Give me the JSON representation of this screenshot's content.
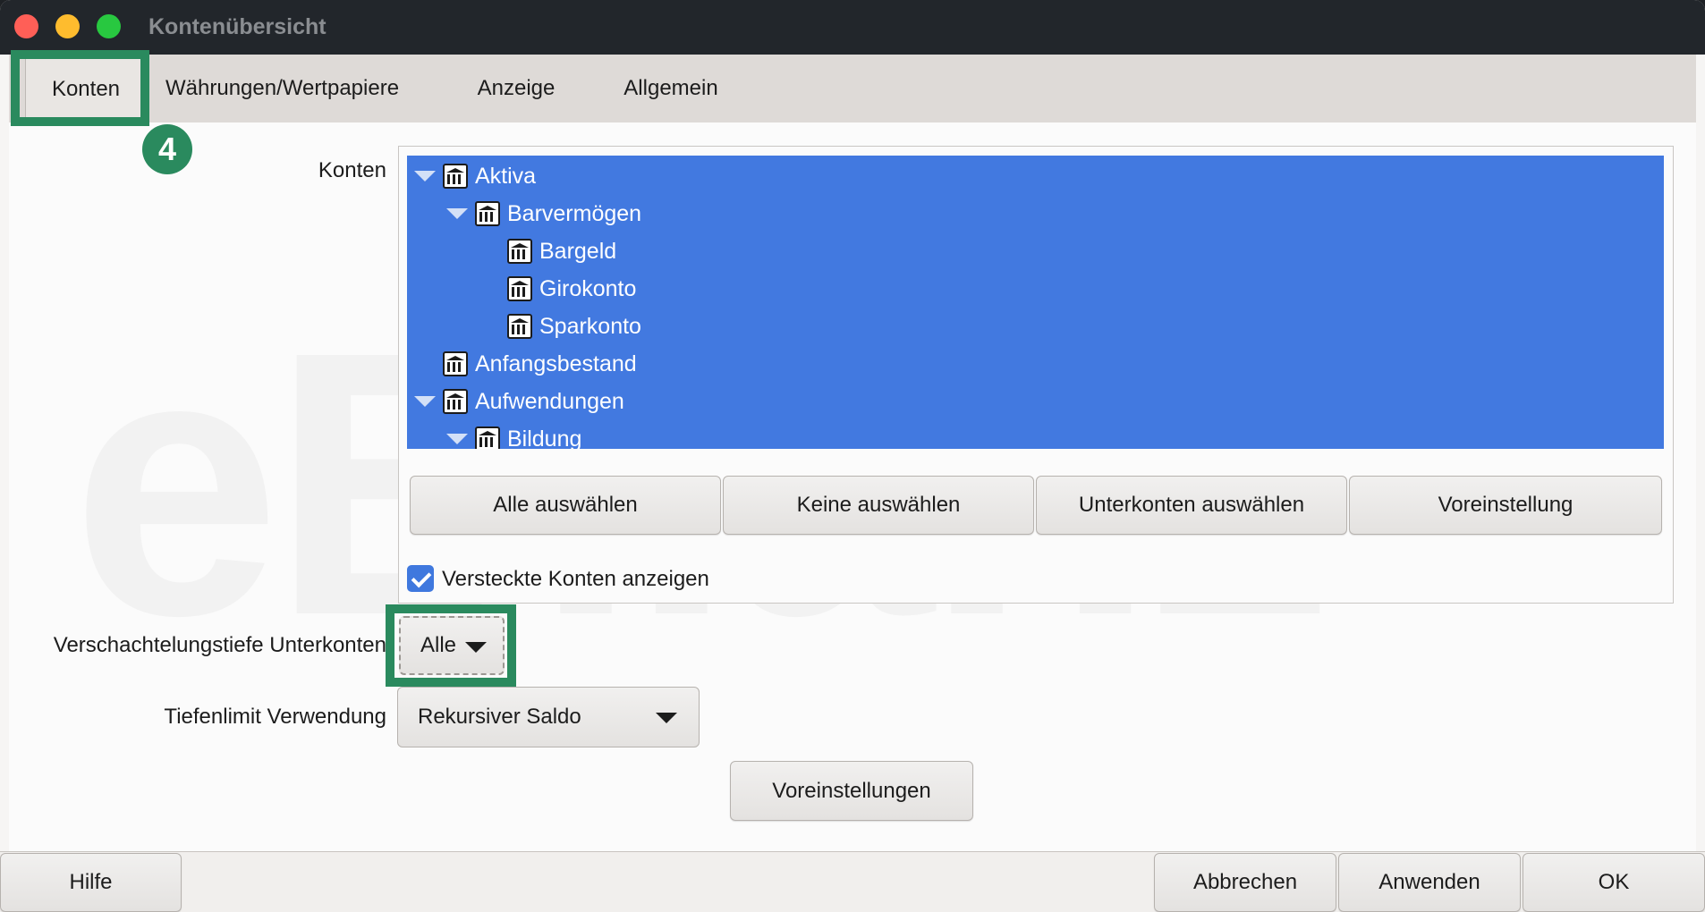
{
  "window": {
    "title": "Kontenübersicht"
  },
  "tabs": [
    {
      "label": "Konten",
      "active": true
    },
    {
      "label": "Währungen/Wertpapiere",
      "active": false
    },
    {
      "label": "Anzeige",
      "active": false
    },
    {
      "label": "Allgemein",
      "active": false
    }
  ],
  "annotation": {
    "step_badge": "4",
    "highlight_color": "#2a8a5e"
  },
  "watermark": "eBilanz+",
  "accounts": {
    "label": "Konten",
    "tree": [
      {
        "name": "Aktiva",
        "expanded": true,
        "level": 0
      },
      {
        "name": "Barvermögen",
        "expanded": true,
        "level": 1
      },
      {
        "name": "Bargeld",
        "level": 2
      },
      {
        "name": "Girokonto",
        "level": 2
      },
      {
        "name": "Sparkonto",
        "level": 2
      },
      {
        "name": "Anfangsbestand",
        "level": 0
      },
      {
        "name": "Aufwendungen",
        "expanded": true,
        "level": 0
      },
      {
        "name": "Bildung",
        "expanded": true,
        "level": 1
      }
    ],
    "buttons": {
      "select_all": "Alle auswählen",
      "select_none": "Keine auswählen",
      "select_sub": "Unterkonten auswählen",
      "default": "Voreinstellung"
    },
    "show_hidden": {
      "label": "Versteckte Konten anzeigen",
      "checked": true
    }
  },
  "depth": {
    "label": "Verschachtelungstiefe Unterkonten",
    "value": "Alle"
  },
  "depth_limit": {
    "label": "Tiefenlimit Verwendung",
    "value": "Rekursiver Saldo"
  },
  "defaults_button": "Voreinstellungen",
  "footer": {
    "help": "Hilfe",
    "cancel": "Abbrechen",
    "apply": "Anwenden",
    "ok": "OK"
  },
  "colors": {
    "selection": "#4279e0",
    "titlebar": "#22262b",
    "accent_green": "#2a8a5e"
  }
}
